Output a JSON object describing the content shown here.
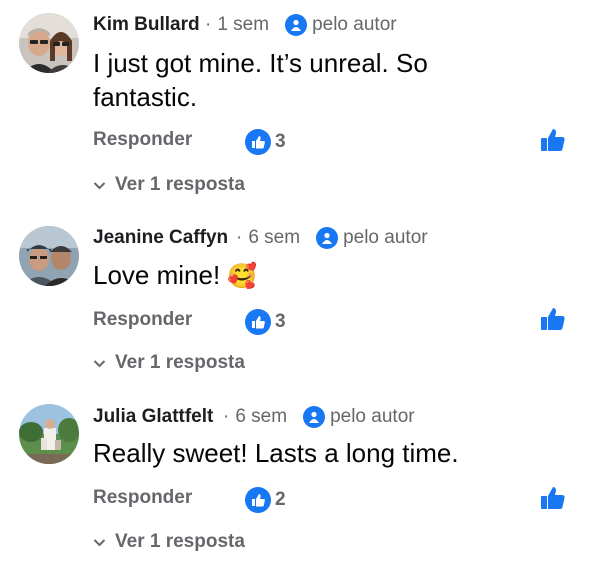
{
  "comments": [
    {
      "author": "Kim Bullard",
      "time": "1 sem",
      "badge_label": "pelo autor",
      "text": "I just got mine.  It’s unreal.  So fantastic.",
      "reply_label": "Responder",
      "reaction_count": "3",
      "view_replies_label": "Ver 1 resposta"
    },
    {
      "author": "Jeanine Caffyn",
      "time": "6 sem",
      "badge_label": "pelo autor",
      "text": "Love mine!",
      "emoji": "🥰",
      "reply_label": "Responder",
      "reaction_count": "3",
      "view_replies_label": "Ver 1 resposta"
    },
    {
      "author": "Julia Glattfelt",
      "time": "6 sem",
      "badge_label": "pelo autor",
      "text": "Really sweet! Lasts a long time.",
      "reply_label": "Responder",
      "reaction_count": "2",
      "view_replies_label": "Ver 1 resposta"
    }
  ],
  "colors": {
    "accent": "#1877f2",
    "name_text": "#1c1e21",
    "secondary_text": "#65676b",
    "body_text": "#050505"
  },
  "icons": {
    "author_badge": "pen-badge-icon",
    "reaction": "thumbs-up-icon",
    "like_button": "thumbs-up-icon",
    "expand": "chevron-down-icon"
  }
}
